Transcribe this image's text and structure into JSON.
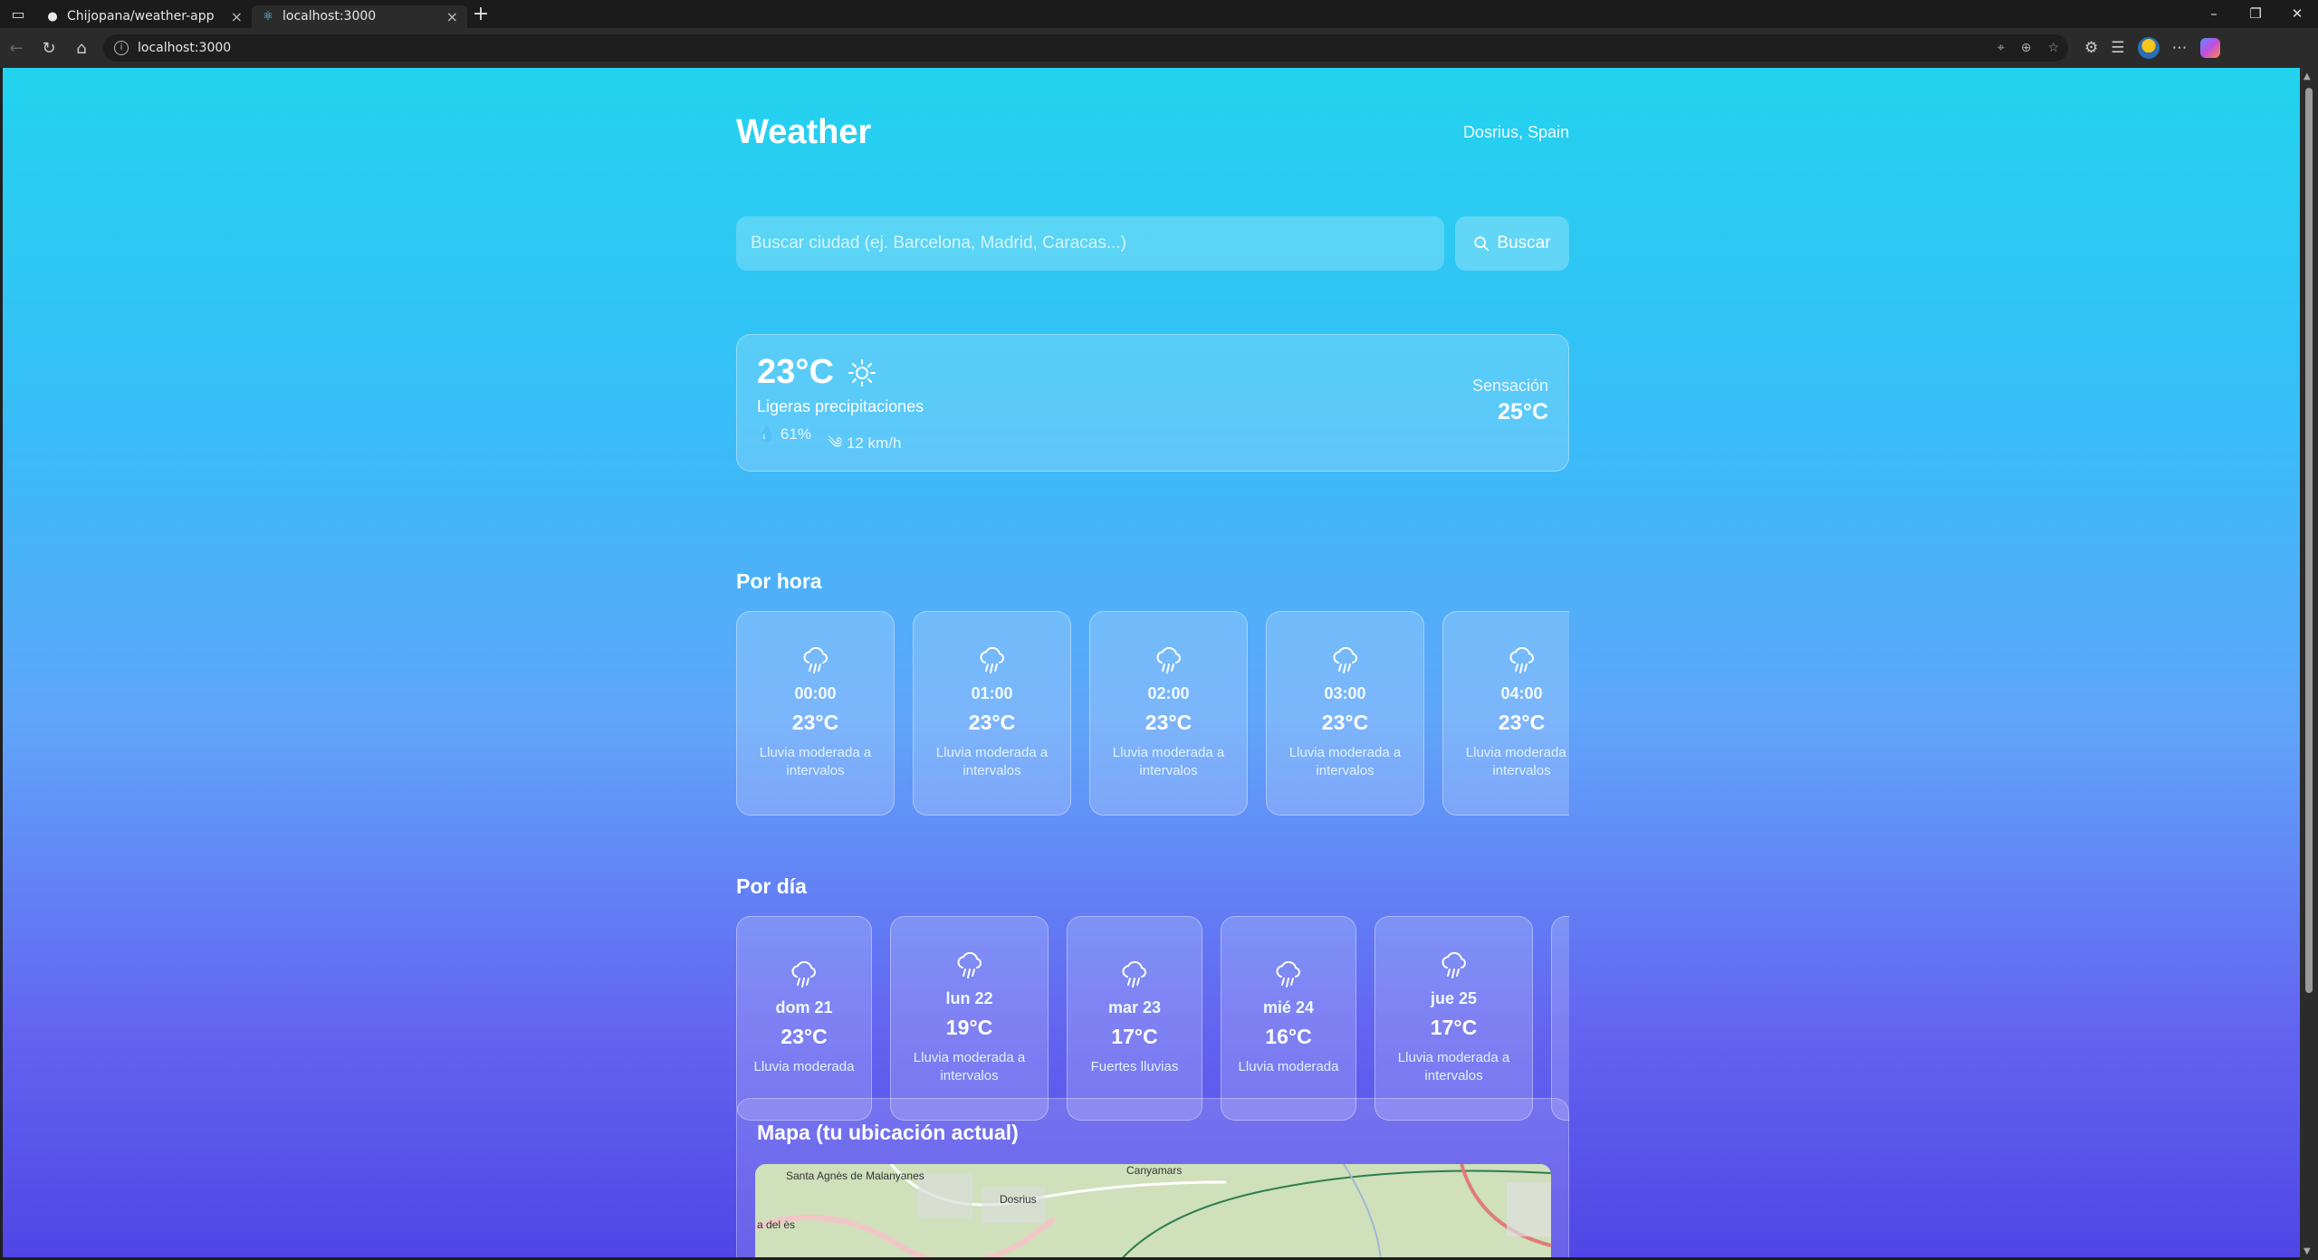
{
  "browser": {
    "tabs": [
      {
        "title": "Chijopana/weather-app",
        "active": false
      },
      {
        "title": "localhost:3000",
        "active": true
      }
    ],
    "url": "localhost:3000"
  },
  "app": {
    "title": "Weather",
    "location": "Dosrius, Spain",
    "search": {
      "placeholder": "Buscar ciudad (ej. Barcelona, Madrid, Caracas...)",
      "button_label": "Buscar"
    },
    "current": {
      "temp": "23°C",
      "description": "Ligeras precipitaciones",
      "humidity": "61%",
      "wind": "12 km/h",
      "feels_label": "Sensación",
      "feels_value": "25°C",
      "icon": "sun-icon"
    },
    "hourly_title": "Por hora",
    "hourly": [
      {
        "time": "00:00",
        "temp": "23°C",
        "desc": "Lluvia moderada a intervalos"
      },
      {
        "time": "01:00",
        "temp": "23°C",
        "desc": "Lluvia moderada a intervalos"
      },
      {
        "time": "02:00",
        "temp": "23°C",
        "desc": "Lluvia moderada a intervalos"
      },
      {
        "time": "03:00",
        "temp": "23°C",
        "desc": "Lluvia moderada a intervalos"
      },
      {
        "time": "04:00",
        "temp": "23°C",
        "desc": "Lluvia moderada a intervalos"
      }
    ],
    "daily_title": "Por día",
    "daily": [
      {
        "day": "dom 21",
        "temp": "23°C",
        "desc": "Lluvia moderada"
      },
      {
        "day": "lun 22",
        "temp": "19°C",
        "desc": "Lluvia moderada a intervalos"
      },
      {
        "day": "mar 23",
        "temp": "17°C",
        "desc": "Fuertes lluvias"
      },
      {
        "day": "mié 24",
        "temp": "16°C",
        "desc": "Lluvia moderada"
      },
      {
        "day": "jue 25",
        "temp": "17°C",
        "desc": "Lluvia moderada a intervalos"
      }
    ],
    "map_title": "Mapa (tu ubicación actual)",
    "map_labels": [
      "Santa Agnès de Malanyanes",
      "Dosrius",
      "Canyamars",
      "a del ès"
    ]
  }
}
